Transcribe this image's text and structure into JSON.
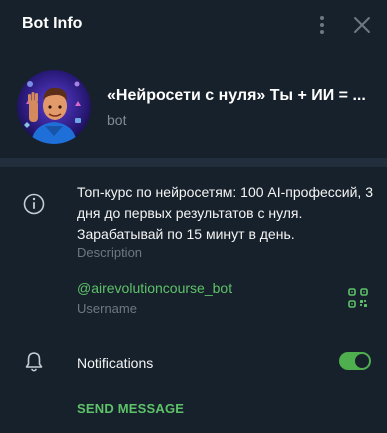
{
  "header": {
    "title": "Bot Info",
    "more_icon": "vertical-dots-icon",
    "close_icon": "close-icon"
  },
  "profile": {
    "name": "«Нейросети с нуля» Ты + ИИ = ...",
    "kind": "bot"
  },
  "info": {
    "description": "Топ-курс по нейросетям: 100 AI-профессий, 3 дня до первых результатов с нуля. Зарабатывай по 15 минут в день.",
    "description_label": "Description",
    "username": "@airevolutioncourse_bot",
    "username_label": "Username"
  },
  "notifications": {
    "label": "Notifications",
    "enabled": true
  },
  "actions": {
    "send_message": "SEND MESSAGE"
  },
  "colors": {
    "background": "#17212b",
    "divider": "#232e3c",
    "accent": "#5ec26a",
    "toggle_on": "#4fae4e",
    "muted": "#6d7883"
  }
}
